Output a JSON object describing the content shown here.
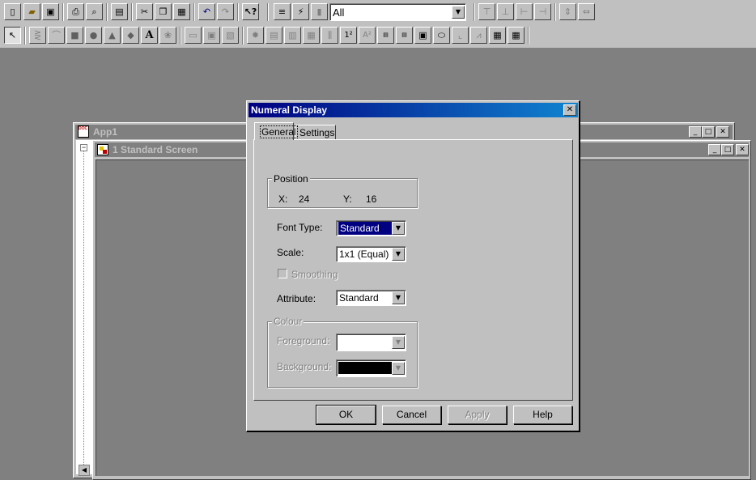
{
  "toolbar1": {
    "filter_value": "All",
    "icons": [
      "new-file-icon",
      "open-folder-icon",
      "save-icon",
      "print-icon",
      "print-preview-icon",
      "import-image-icon",
      "cut-icon",
      "copy-icon",
      "paste-icon",
      "undo-icon",
      "redo-icon",
      "context-help-icon",
      "align-text-icon",
      "tool-icon",
      "bar-icon",
      "align-top-icon",
      "align-bottom-icon",
      "align-left-icon",
      "align-right-icon",
      "space-vertical-icon",
      "space-horizontal-icon"
    ]
  },
  "toolbar2": {
    "text_tool_glyph": "A",
    "icons": [
      "select-pointer-icon",
      "polyline-icon",
      "arc-icon",
      "rectangle-icon",
      "circle-icon",
      "polygon-icon",
      "diamond-icon",
      "text-tool-icon",
      "bitmap-icon",
      "text-field-icon",
      "frame-icon",
      "group-icon",
      "lamp-icon",
      "switch-icon",
      "bar-graph-icon",
      "meter-icon",
      "multi-bar-icon",
      "numeral-icon",
      "ascii-icon",
      "keypad-icon",
      "ascii-entry-icon",
      "message-icon",
      "trend-icon",
      "chart-icon",
      "xy-plot-icon",
      "table-icon",
      "alarm-icon"
    ]
  },
  "app_window": {
    "title": "App1"
  },
  "screen_window": {
    "title": "1 Standard Screen"
  },
  "dialog": {
    "title": "Numeral Display",
    "tabs": [
      {
        "label": "General",
        "active": true
      },
      {
        "label": "Settings",
        "active": false
      }
    ],
    "position": {
      "group_label": "Position",
      "x_label": "X:",
      "x_value": "24",
      "y_label": "Y:",
      "y_value": "16"
    },
    "font_type": {
      "label": "Font Type:",
      "value": "Standard"
    },
    "scale": {
      "label": "Scale:",
      "value": "1x1 (Equal)"
    },
    "smoothing": {
      "label": "Smoothing",
      "checked": false,
      "enabled": false
    },
    "attribute": {
      "label": "Attribute:",
      "value": "Standard"
    },
    "colour": {
      "group_label": "Colour",
      "foreground_label": "Foreground:",
      "foreground_color": "#ffffff",
      "background_label": "Background:",
      "background_color": "#000000"
    },
    "buttons": {
      "ok": "OK",
      "cancel": "Cancel",
      "apply": "Apply",
      "help": "Help"
    }
  },
  "colors": {
    "active_title_start": "#000080",
    "active_title_end": "#1084d0",
    "face": "#c0c0c0",
    "workspace": "#808080"
  }
}
